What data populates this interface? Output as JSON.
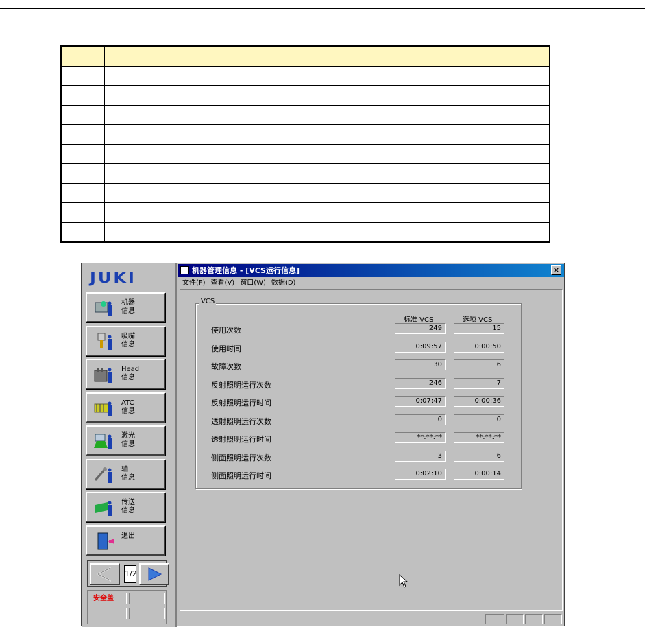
{
  "spec_table": {
    "header": [
      "",
      "",
      ""
    ],
    "rows": [
      [
        "",
        "",
        ""
      ],
      [
        "",
        "",
        ""
      ],
      [
        "",
        "",
        ""
      ],
      [
        "",
        "",
        ""
      ],
      [
        "",
        "",
        ""
      ],
      [
        "",
        "",
        ""
      ],
      [
        "",
        "",
        ""
      ],
      [
        "",
        "",
        ""
      ],
      [
        "",
        "",
        ""
      ]
    ]
  },
  "app": {
    "logo": "JUKI",
    "nav_buttons": [
      {
        "label": "机器\n信息",
        "icon": "machine-info-icon"
      },
      {
        "label": "吸嘴\n信息",
        "icon": "nozzle-info-icon"
      },
      {
        "label": "Head\n信息",
        "icon": "head-info-icon"
      },
      {
        "label": "ATC\n信息",
        "icon": "atc-info-icon"
      },
      {
        "label": "激光\n信息",
        "icon": "laser-info-icon"
      },
      {
        "label": "轴\n信息",
        "icon": "axis-info-icon"
      },
      {
        "label": "传送\n信息",
        "icon": "conveyor-info-icon"
      },
      {
        "label": "退出",
        "icon": "exit-door-icon"
      }
    ],
    "pager": {
      "page": "1/2"
    },
    "status": {
      "safety_cover": "安全盖"
    }
  },
  "window": {
    "title": "机器管理信息 - [VCS运行信息]",
    "close": "×",
    "menu": [
      "文件(F)",
      "查看(V)",
      "窗口(W)",
      "数据(D)"
    ],
    "group_title": "VCS",
    "col_standard": "标准 VCS",
    "col_option": "选项 VCS",
    "rows": [
      {
        "label": "使用次数",
        "standard": "249",
        "option": "15"
      },
      {
        "label": "使用时间",
        "standard": "0:09:57",
        "option": "0:00:50"
      },
      {
        "label": "故障次数",
        "standard": "30",
        "option": "6"
      },
      {
        "label": "反射照明运行次数",
        "standard": "246",
        "option": "7"
      },
      {
        "label": "反射照明运行时间",
        "standard": "0:07:47",
        "option": "0:00:36"
      },
      {
        "label": "透射照明运行次数",
        "standard": "0",
        "option": "0"
      },
      {
        "label": "透射照明运行时间",
        "standard": "**:**:**",
        "option": "**:**:**"
      },
      {
        "label": "侧面照明运行次数",
        "standard": "3",
        "option": "6"
      },
      {
        "label": "侧面照明运行时间",
        "standard": "0:02:10",
        "option": "0:00:14"
      }
    ]
  },
  "colors": {
    "table_header": "#fff7c0",
    "title_bar": "#000080",
    "logo": "#1a3fb0",
    "safety_text": "#e00000"
  }
}
